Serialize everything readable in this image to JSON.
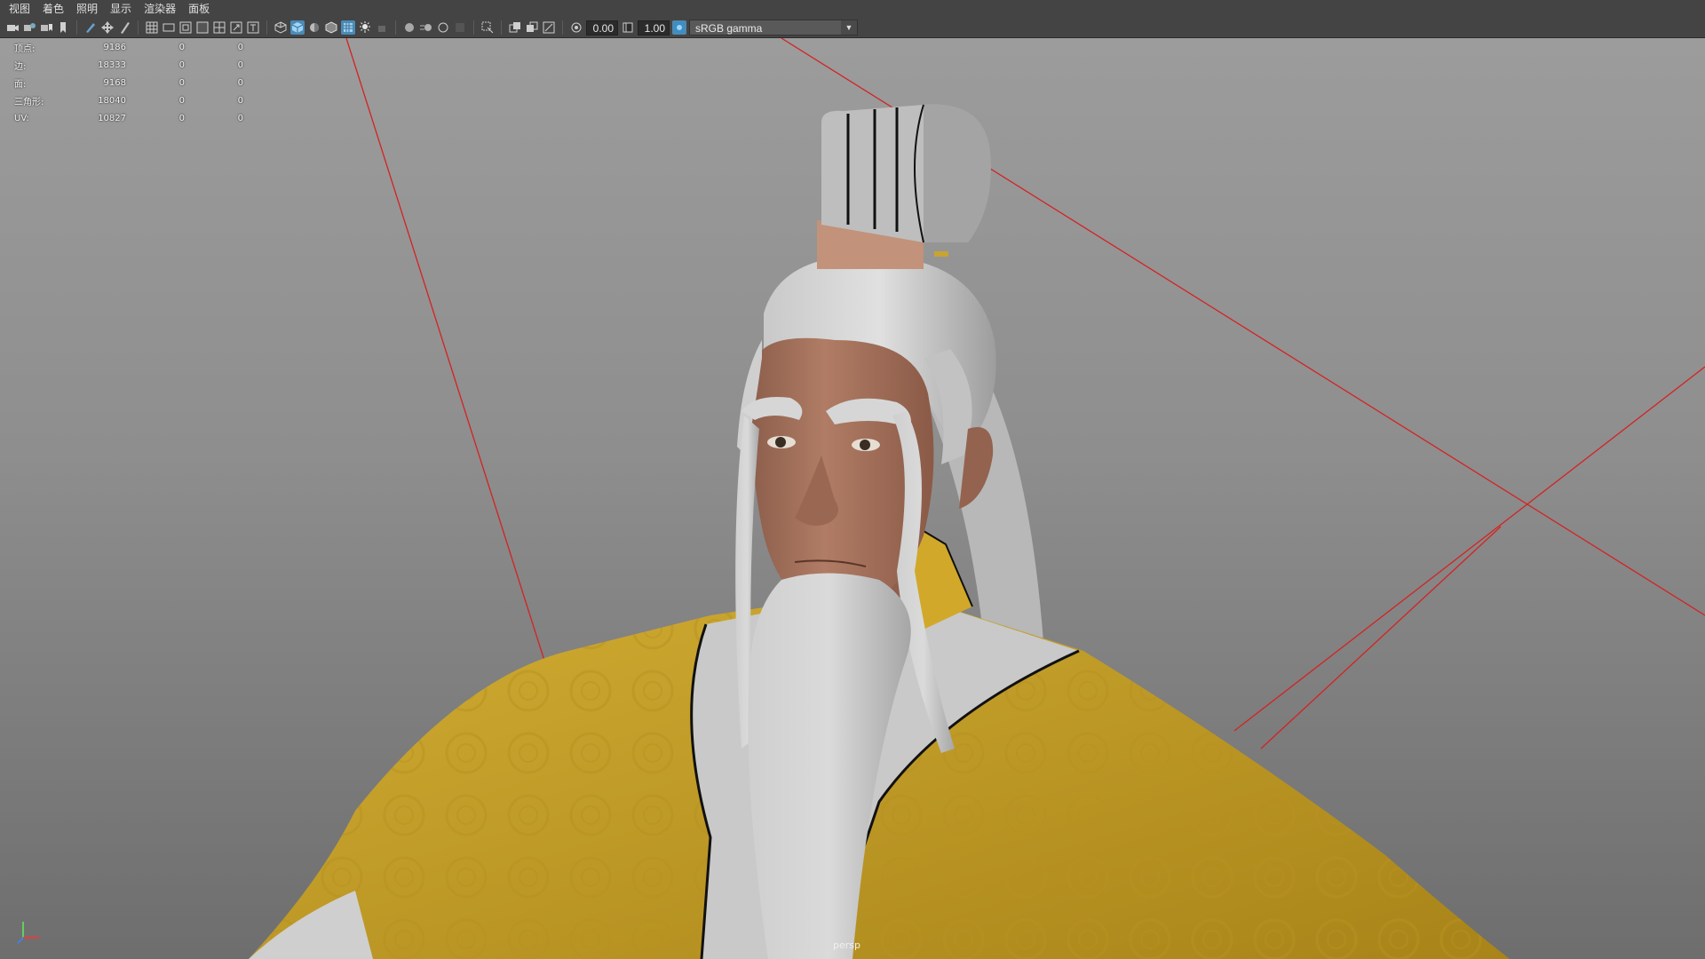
{
  "menu": [
    "视图",
    "着色",
    "照明",
    "显示",
    "渲染器",
    "面板"
  ],
  "toolbar": {
    "icons": [
      "camera-select-icon",
      "camera-attributes-icon",
      "bookmark-icon",
      "image-plane-icon",
      "grid-toggle-icon",
      "film-gate-icon",
      "resolution-gate-icon",
      "gate-mask-icon",
      "field-chart-icon",
      "safe-action-icon",
      "safe-title-icon",
      "wireframe-icon",
      "smooth-shade-icon",
      "default-material-icon",
      "wireframe-on-shaded-icon",
      "textured-icon",
      "use-lights-icon",
      "shadows-icon",
      "ambient-occlusion-icon",
      "motion-blur-icon",
      "anti-aliasing-icon",
      "depth-of-field-icon",
      "isolate-select-icon",
      "xray-icon",
      "xray-joints-icon",
      "xray-components-icon",
      "exposure-icon",
      "gamma-icon",
      "color-management-icon"
    ],
    "exposure_value": "0.00",
    "gamma_value": "1.00",
    "color_space": "sRGB gamma"
  },
  "hud": {
    "rows": [
      {
        "label": "顶点:",
        "value": "9186",
        "a": "0",
        "b": "0"
      },
      {
        "label": "边:",
        "value": "18333",
        "a": "0",
        "b": "0"
      },
      {
        "label": "面:",
        "value": "9168",
        "a": "0",
        "b": "0"
      },
      {
        "label": "三角形:",
        "value": "18040",
        "a": "0",
        "b": "0"
      },
      {
        "label": "UV:",
        "value": "10827",
        "a": "0",
        "b": "0"
      }
    ]
  },
  "camera_name": "persp",
  "colors": {
    "ui_bg": "#444444",
    "accent": "#4a8bb5",
    "robe_yellow": "#c9a52b",
    "inner_robe": "#cfcfcf",
    "skin": "#a3705a",
    "hair": "#d2d2d2",
    "grid_line": "#d42222"
  }
}
